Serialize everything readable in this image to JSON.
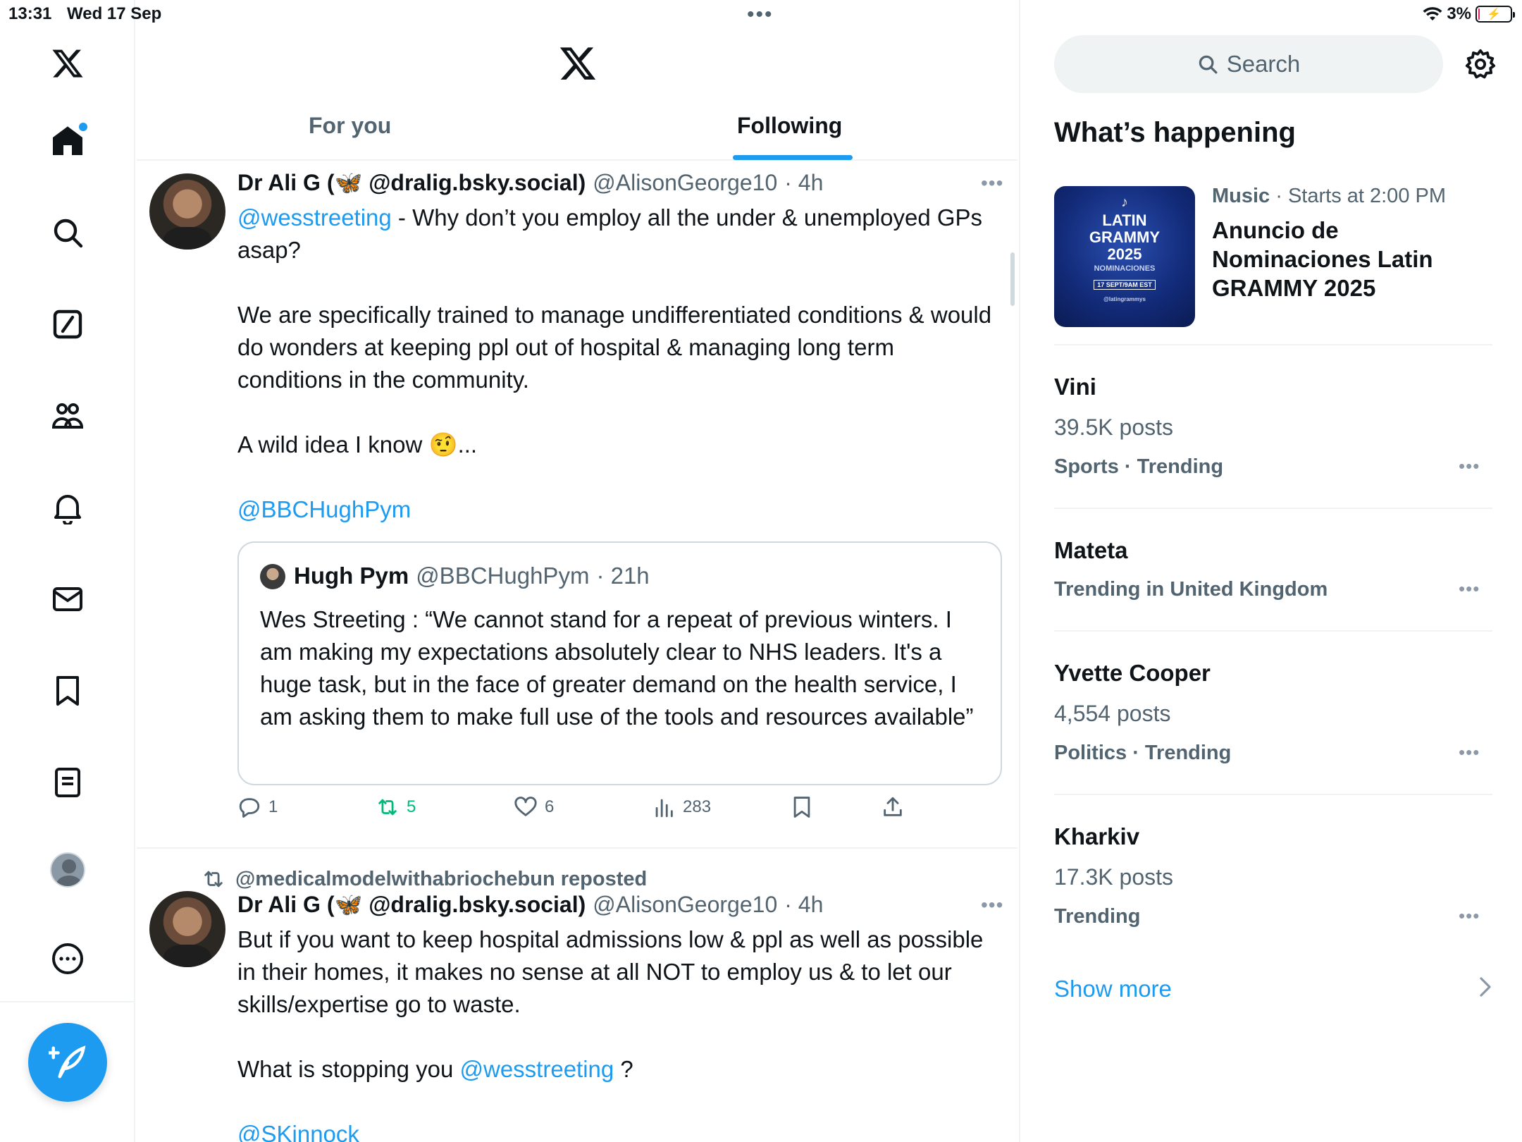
{
  "status_bar": {
    "time": "13:31",
    "date": "Wed 17 Sep",
    "battery_percent": "3%",
    "battery_level": 0.03
  },
  "nav": {
    "items": [
      {
        "icon": "x-logo-icon"
      },
      {
        "icon": "home-icon",
        "has_notification_dot": true
      },
      {
        "icon": "search-icon"
      },
      {
        "icon": "grok-icon"
      },
      {
        "icon": "communities-icon"
      },
      {
        "icon": "notifications-icon"
      },
      {
        "icon": "messages-icon"
      },
      {
        "icon": "bookmarks-icon"
      },
      {
        "icon": "lists-icon"
      },
      {
        "icon": "profile-icon"
      },
      {
        "icon": "more-icon"
      }
    ],
    "compose_icon": "compose-icon"
  },
  "header": {
    "tabs": [
      {
        "label": "For you",
        "active": false
      },
      {
        "label": "Following",
        "active": true
      }
    ]
  },
  "posts": [
    {
      "author": "Dr Ali G (🦋 @dralig.bsky.social)",
      "handle": "@AlisonGeorge10",
      "time": "· 4h",
      "body": {
        "l1_mention": "@wesstreeting",
        "l1_rest": " - Why don’t you employ all the under & unemployed GPs asap?",
        "p2": "We are specifically trained to manage undifferentiated conditions & would do wonders at keeping ppl out of hospital & managing long term conditions in the community.",
        "p3_text": "A wild idea I know ",
        "p3_emoji": "🤨",
        "p3_tail": "...",
        "p4_mention": "@BBCHughPym"
      },
      "quote": {
        "author": "Hugh Pym",
        "handle": "@BBCHughPym",
        "time": "· 21h",
        "text": "Wes Streeting : “We cannot stand for a repeat of previous winters. I am making my expectations absolutely clear to NHS leaders. It's a huge task, but in the face of greater demand on the health service, I am asking them to make full use of the tools and resources available”"
      },
      "actions": {
        "replies": "1",
        "reposts": "5",
        "likes": "6",
        "views": "283"
      }
    },
    {
      "reposted_by": "@medicalmodelwithabriochebun reposted",
      "author": "Dr Ali G (🦋 @dralig.bsky.social)",
      "handle": "@AlisonGeorge10",
      "time": "· 4h",
      "body": {
        "p1": "But if you want to keep hospital admissions low & ppl as well as possible in their homes, it makes no sense at all NOT to employ us & to let our skills/expertise go to waste.",
        "p2_text": "What is stopping you ",
        "p2_mention": "@wesstreeting",
        "p2_tail": " ?",
        "p3_mention": "@SKinnock"
      }
    }
  ],
  "sidebar": {
    "search_placeholder": "Search",
    "title": "What’s happening",
    "event": {
      "category": "Music",
      "meta": " · Starts at 2:00 PM",
      "title": "Anuncio de Nominaciones Latin GRAMMY 2025",
      "thumb_line1": "LATIN",
      "thumb_line2": "GRAMMY",
      "thumb_line3": "2025",
      "thumb_line4": "NOMINACIONES",
      "thumb_line5": "17 SEPT/9AM EST",
      "thumb_line6": "@latingrammys"
    },
    "trends": [
      {
        "topic": "Vini",
        "count": "39.5K posts",
        "meta": "Sports · Trending"
      },
      {
        "topic": "Mateta",
        "count": "",
        "meta": "Trending in United Kingdom"
      },
      {
        "topic": "Yvette Cooper",
        "count": "4,554 posts",
        "meta": "Politics · Trending"
      },
      {
        "topic": "Kharkiv",
        "count": "17.3K posts",
        "meta": "Trending"
      }
    ],
    "show_more": "Show more"
  }
}
